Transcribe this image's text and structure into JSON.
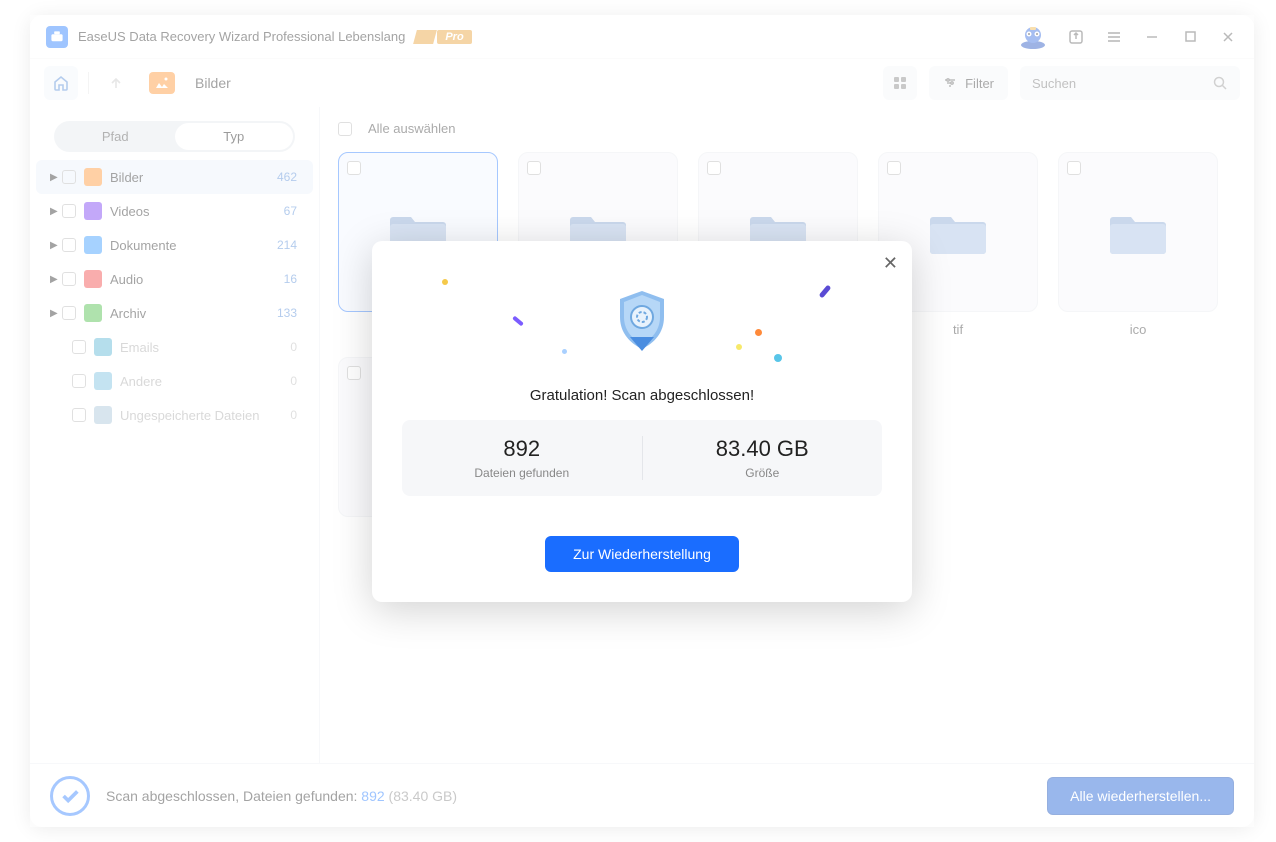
{
  "titlebar": {
    "title": "EaseUS Data Recovery Wizard Professional Lebenslang",
    "pro_label": "Pro"
  },
  "toolbar": {
    "breadcrumb_label": "Bilder",
    "filter_label": "Filter",
    "search_placeholder": "Suchen"
  },
  "sidebar": {
    "tabs": {
      "path": "Pfad",
      "type": "Typ"
    },
    "items": [
      {
        "label": "Bilder",
        "count": "462",
        "icon": "ci-orange",
        "expandable": true,
        "active": true
      },
      {
        "label": "Videos",
        "count": "67",
        "icon": "ci-purple",
        "expandable": true
      },
      {
        "label": "Dokumente",
        "count": "214",
        "icon": "ci-blue",
        "expandable": true
      },
      {
        "label": "Audio",
        "count": "16",
        "icon": "ci-red",
        "expandable": true
      },
      {
        "label": "Archiv",
        "count": "133",
        "icon": "ci-green",
        "expandable": true
      },
      {
        "label": "Emails",
        "count": "0",
        "icon": "ci-teal",
        "disabled": true
      },
      {
        "label": "Andere",
        "count": "0",
        "icon": "ci-cyan",
        "disabled": true
      },
      {
        "label": "Ungespeicherte Dateien",
        "count": "0",
        "icon": "ci-gray",
        "disabled": true
      }
    ]
  },
  "content": {
    "select_all_label": "Alle auswählen",
    "folders": [
      {
        "label": "",
        "selected": true
      },
      {
        "label": ""
      },
      {
        "label": ""
      },
      {
        "label": "tif"
      },
      {
        "label": "ico"
      },
      {
        "label": ""
      }
    ]
  },
  "footer": {
    "status_prefix": "Scan abgeschlossen, Dateien gefunden: ",
    "status_count": "892",
    "status_size": " (83.40 GB)",
    "recover_all": "Alle wiederherstellen..."
  },
  "modal": {
    "title": "Gratulation! Scan abgeschlossen!",
    "files_value": "892",
    "files_label": "Dateien gefunden",
    "size_value": "83.40 GB",
    "size_label": "Größe",
    "button": "Zur Wiederherstellung"
  }
}
